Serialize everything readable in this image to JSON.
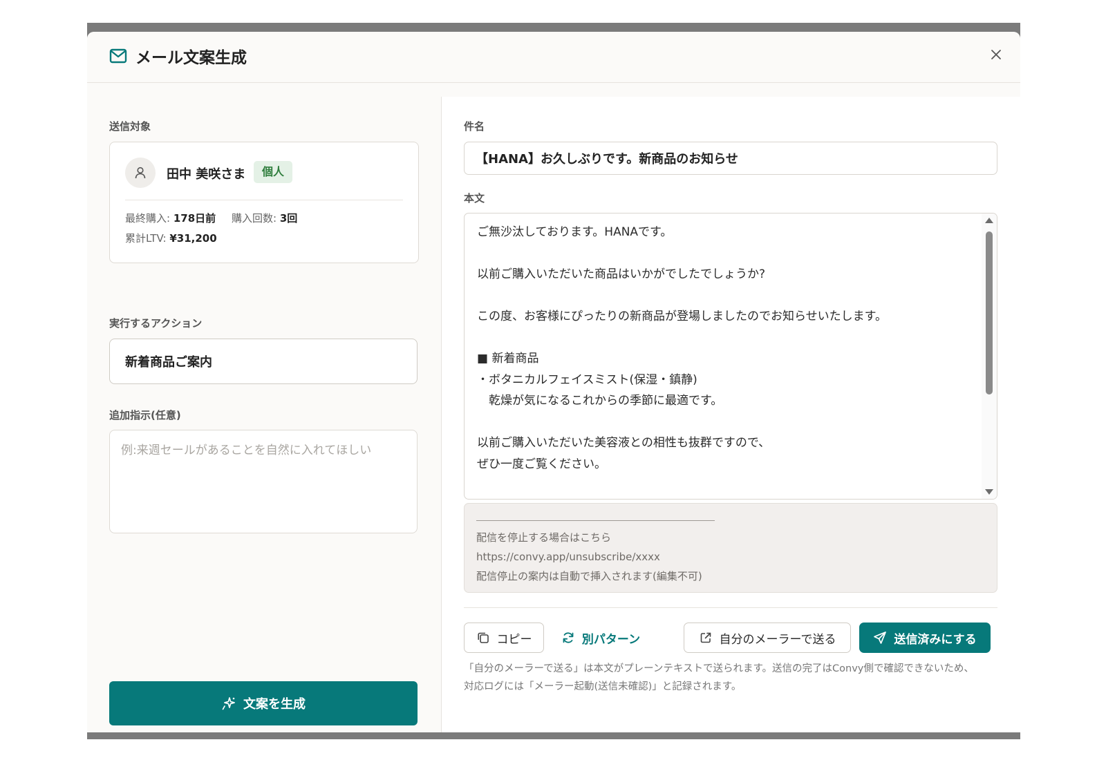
{
  "modal": {
    "title": "メール文案生成",
    "icons": {
      "title": "mail-icon",
      "close": "close-icon"
    }
  },
  "left": {
    "target_label": "送信対象",
    "customer": {
      "name": "田中 美咲さま",
      "badge": "個人",
      "last_purchase_label": "最終購入:",
      "last_purchase_value": "178日前",
      "purchase_count_label": "購入回数:",
      "purchase_count_value": "3回",
      "ltv_label": "累計LTV:",
      "ltv_value": "¥31,200"
    },
    "action_label": "実行するアクション",
    "action_value": "新着商品ご案内",
    "instruction_label": "追加指示(任意)",
    "instruction_placeholder": "例:来週セールがあることを自然に入れてほしい",
    "generate_label": "文案を生成"
  },
  "right": {
    "subject_label": "件名",
    "subject_value": "【HANA】お久しぶりです。新商品のお知らせ",
    "body_label": "本文",
    "body_value": "ご無沙汰しております。HANAです。\n\n以前ご購入いただいた商品はいかがでしたでしょうか?\n\nこの度、お客様にぴったりの新商品が登場しましたのでお知らせいたします。\n\n■ 新着商品\n・ボタニカルフェイスミスト(保湿・鎮静)\n　乾燥が気になるこれからの季節に最適です。\n\n以前ご購入いただいた美容液との相性も抜群ですので、\nぜひ一度ご覧ください。",
    "footer": {
      "unsubscribe_text": "配信を停止する場合はこちら",
      "unsubscribe_url": "https://convy.app/unsubscribe/xxxx",
      "auto_note": "配信停止の案内は自動で挿入されます(編集不可)"
    },
    "buttons": {
      "copy": "コピー",
      "alt_pattern": "別パターン",
      "open_mailer": "自分のメーラーで送る",
      "mark_sent": "送信済みにする"
    },
    "note_line1": "「自分のメーラーで送る」は本文がプレーンテキストで送られます。送信の完了はConvy側で確認できないため、",
    "note_line2": "対応ログには「メーラー起動(送信未確認)」と記録されます。"
  },
  "colors": {
    "accent": "#07797a",
    "badge_bg": "#e4f1e6",
    "badge_text": "#2e7d3c"
  }
}
